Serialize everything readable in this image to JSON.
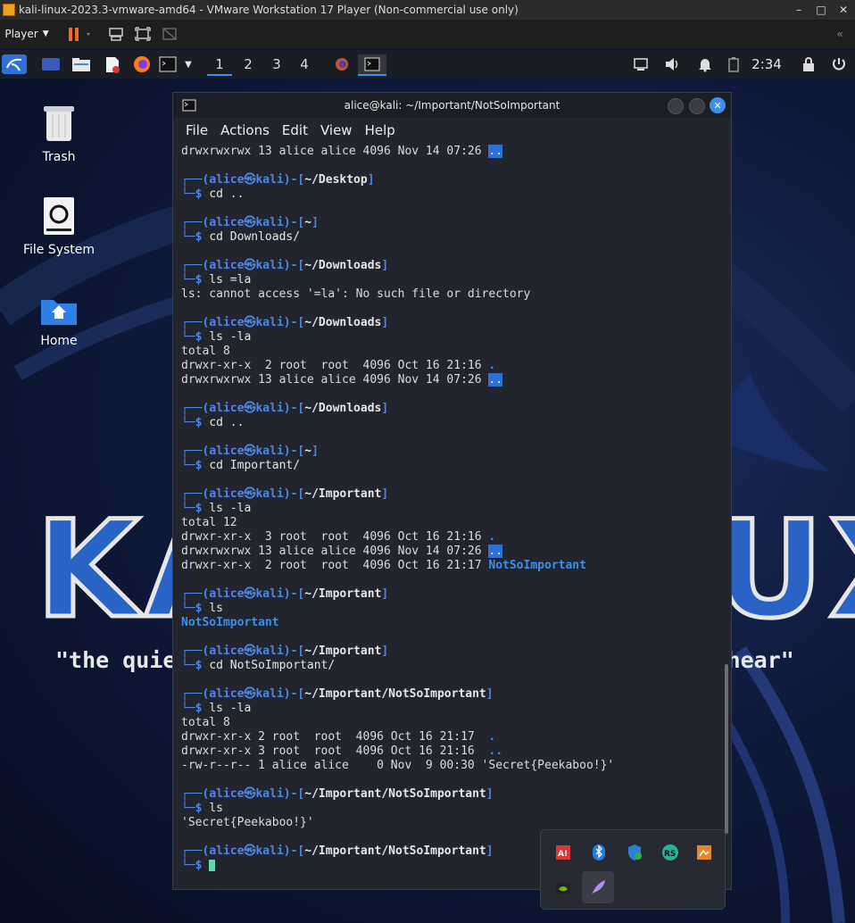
{
  "vmware": {
    "window_title": "kali-linux-2023.3-vmware-amd64 - VMware Workstation 17 Player (Non-commercial use only)",
    "player_menu": "Player",
    "minimize": "–",
    "maximize": "□",
    "close": "✕",
    "collapse": "«"
  },
  "panel": {
    "workspaces": [
      "1",
      "2",
      "3",
      "4"
    ],
    "clock": "2:34"
  },
  "desktop": {
    "icons": [
      {
        "label": "Trash"
      },
      {
        "label": "File System"
      },
      {
        "label": "Home"
      }
    ],
    "wallpaper_big_text": "KALI LINUX",
    "wallpaper_quote": "\"the quieter you become, the more you are able to hear\""
  },
  "terminal": {
    "title": "alice@kali: ~/Important/NotSoImportant",
    "menu": [
      "File",
      "Actions",
      "Edit",
      "View",
      "Help"
    ],
    "user": "alice",
    "host": "kali",
    "lines": [
      "drwxrwxrwx 13 alice alice 4096 Nov 14 07:26 ",
      "",
      "",
      "",
      "",
      "",
      "",
      "",
      "",
      "ls: cannot access '=la': No such file or directory",
      "",
      "",
      "",
      "total 8",
      "drwxr-xr-x  2 root  root  4096 Oct 16 21:16 ",
      "drwxrwxrwx 13 alice alice 4096 Nov 14 07:26 ",
      "",
      "",
      "",
      "",
      "",
      "",
      "",
      "",
      "",
      "total 12",
      "drwxr-xr-x  3 root  root  4096 Oct 16 21:16 ",
      "drwxrwxrwx 13 alice alice 4096 Nov 14 07:26 ",
      "drwxr-xr-x  2 root  root  4096 Oct 16 21:17 ",
      "",
      "",
      "",
      "",
      "",
      "",
      "",
      "",
      "",
      "",
      "total 8",
      "drwxr-xr-x 2 root  root  4096 Oct 16 21:17  ",
      "drwxr-xr-x 3 root  root  4096 Oct 16 21:16  ",
      "-rw-r--r-- 1 alice alice    0 Nov  9 00:30 'Secret{Peekaboo!}'",
      "",
      "",
      "",
      "'Secret{Peekaboo!}'"
    ],
    "dot": ".",
    "dotdot": "..",
    "dir_notsoimportant": "NotSoImportant",
    "prompts": [
      {
        "path": "~/Desktop",
        "cmd": "cd .."
      },
      {
        "path": "~",
        "cmd": "cd Downloads/"
      },
      {
        "path": "~/Downloads",
        "cmd": "ls =la"
      },
      {
        "path": "~/Downloads",
        "cmd": "ls -la"
      },
      {
        "path": "~/Downloads",
        "cmd": "cd .."
      },
      {
        "path": "~",
        "cmd": "cd Important/"
      },
      {
        "path": "~/Important",
        "cmd": "ls -la"
      },
      {
        "path": "~/Important",
        "cmd": "ls"
      },
      {
        "path": "~/Important",
        "cmd": "cd NotSoImportant/"
      },
      {
        "path": "~/Important/NotSoImportant",
        "cmd": "ls -la"
      },
      {
        "path": "~/Important/NotSoImportant",
        "cmd": "ls"
      },
      {
        "path": "~/Important/NotSoImportant",
        "cmd": ""
      }
    ]
  },
  "tray": {
    "icons": [
      "tray-app-1-icon",
      "bluetooth-icon",
      "security-icon",
      "rs-icon",
      "package-icon",
      "nvidia-icon",
      "feather-icon"
    ]
  },
  "colors": {
    "prompt_blue": "#4d87e6",
    "dir_highlight": "#2f6fd6",
    "cursor": "#5fd7b0"
  }
}
